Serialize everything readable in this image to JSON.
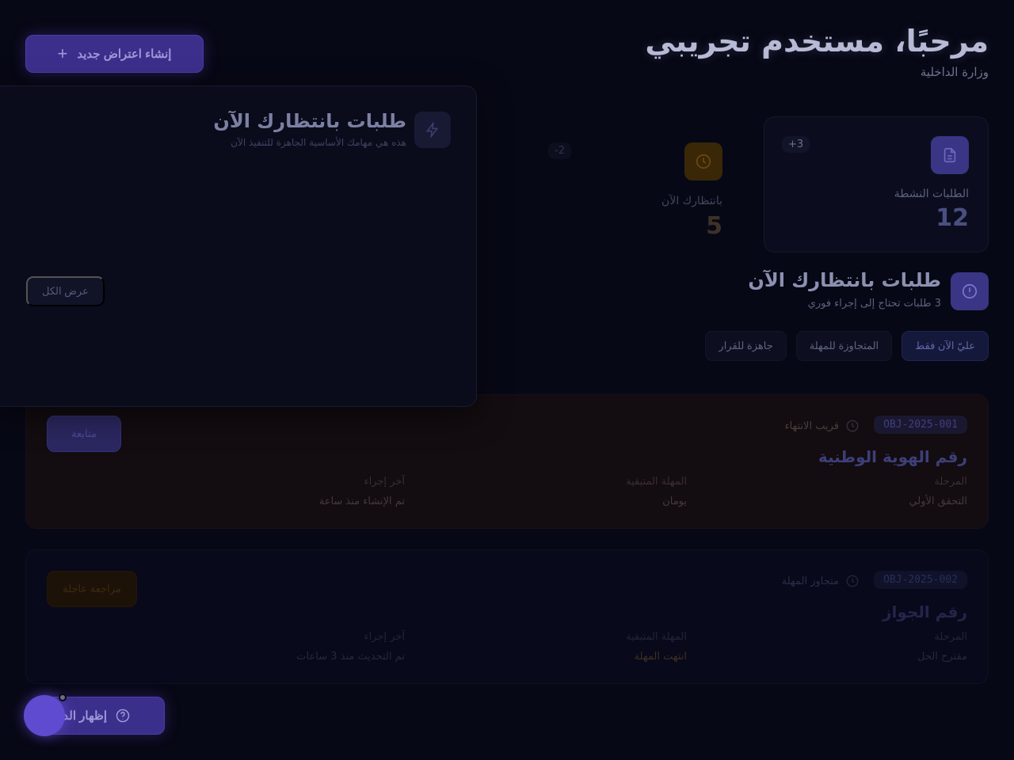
{
  "header": {
    "title": "مرحبًا، مستخدم تجريبي",
    "subtitle": "وزارة الداخلية",
    "create_button_label": "إنشاء اعتراض جديد"
  },
  "stats": [
    {
      "label": "الطلبات النشطة",
      "value": "12",
      "badge": "3+",
      "icon": "document-icon"
    },
    {
      "label": "بانتظارك الآن",
      "value": "5",
      "badge": "2-",
      "icon": "clock-icon"
    }
  ],
  "section": {
    "title": "طلبات بانتظارك الآن",
    "subtitle": "3 طلبات تحتاج إلى إجراء فوري",
    "icon": "alert-circle-icon"
  },
  "filters": [
    "عليّ الآن فقط",
    "المتجاوزة للمهلة",
    "جاهزة للقرار"
  ],
  "popover": {
    "title": "طلبات بانتظارك الآن",
    "subtitle": "هذه هي مهامك الأساسية الجاهزة للتنفيذ الآن",
    "view_all_label": "عرض الكل",
    "icon": "bolt-icon"
  },
  "requests": [
    {
      "id": "OBJ-2025-001",
      "status": "قريب الانتهاء",
      "title": "رقم الهوية الوطنية",
      "fields": [
        {
          "label": "المرحلة",
          "value": "التحقق الأولي"
        },
        {
          "label": "المهلة المتبقية",
          "value": "يومان"
        },
        {
          "label": "آخر إجراء",
          "value": "تم الإنشاء منذ ساعة"
        }
      ],
      "action_label": "متابعة"
    },
    {
      "id": "OBJ-2025-002",
      "status": "متجاوز المهلة",
      "title": "رقم الجواز",
      "fields": [
        {
          "label": "المرحلة",
          "value": "مقترح الحل"
        },
        {
          "label": "المهلة المتبقية",
          "value": "انتهت المهلة"
        },
        {
          "label": "آخر إجراء",
          "value": "تم التحديث منذ 3 ساعات"
        }
      ],
      "action_label": "مراجعة عاجلة"
    }
  ],
  "help": {
    "label": "إظهار الدليل"
  },
  "colors": {
    "accent": "#3b2f8c",
    "warning": "#3a2708",
    "background": "#070815"
  }
}
